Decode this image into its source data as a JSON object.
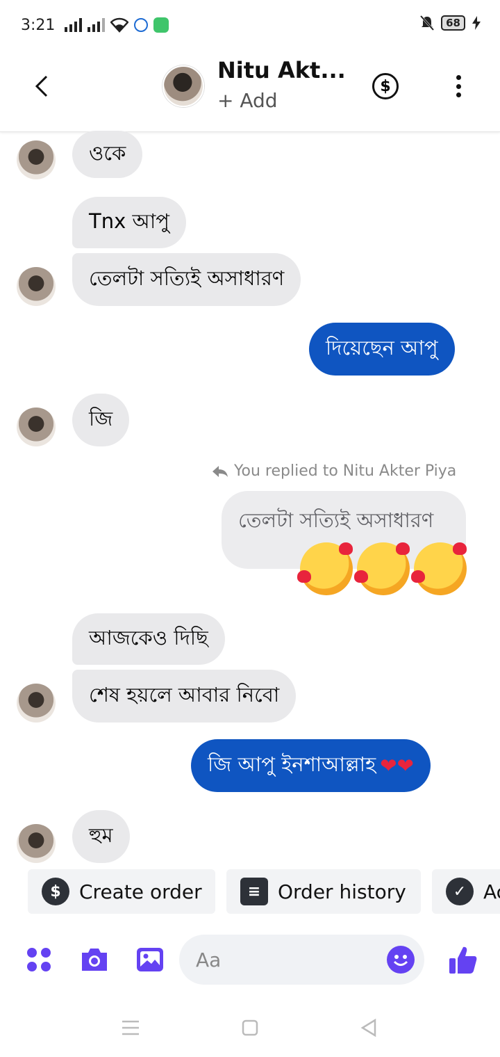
{
  "status": {
    "time": "3:21",
    "battery": "68"
  },
  "header": {
    "name": "Nitu Akt...",
    "add": "+ Add"
  },
  "messages": {
    "m1": "ওকে",
    "m2": "Tnx আপু",
    "m3": "তেলটা সত্যিই অসাধারণ",
    "m4": "দিয়েছেন আপু",
    "m5": "জি",
    "reply_note": "You replied to Nitu Akter Piya",
    "reply_quote": "তেলটা সত্যিই অসাধারণ",
    "m6": "আজকেও দিছি",
    "m7": "শেষ  হয়লে আবার  নিবো",
    "m8": "জি আপু ইনশাআল্লাহ",
    "m8_hearts": "❤❤",
    "m9": "হুম"
  },
  "chips": {
    "create_order": "Create order",
    "order_history": "Order history",
    "third": "Ac"
  },
  "composer": {
    "placeholder": "Aa"
  },
  "colors": {
    "outgoing": "#0f55c1",
    "incoming": "#e9e9eb",
    "accent": "#6442f2"
  },
  "icons": [
    "back-icon",
    "dollar-icon",
    "more-icon",
    "apps-icon",
    "camera-icon",
    "gallery-icon",
    "emoji-icon",
    "like-icon"
  ]
}
